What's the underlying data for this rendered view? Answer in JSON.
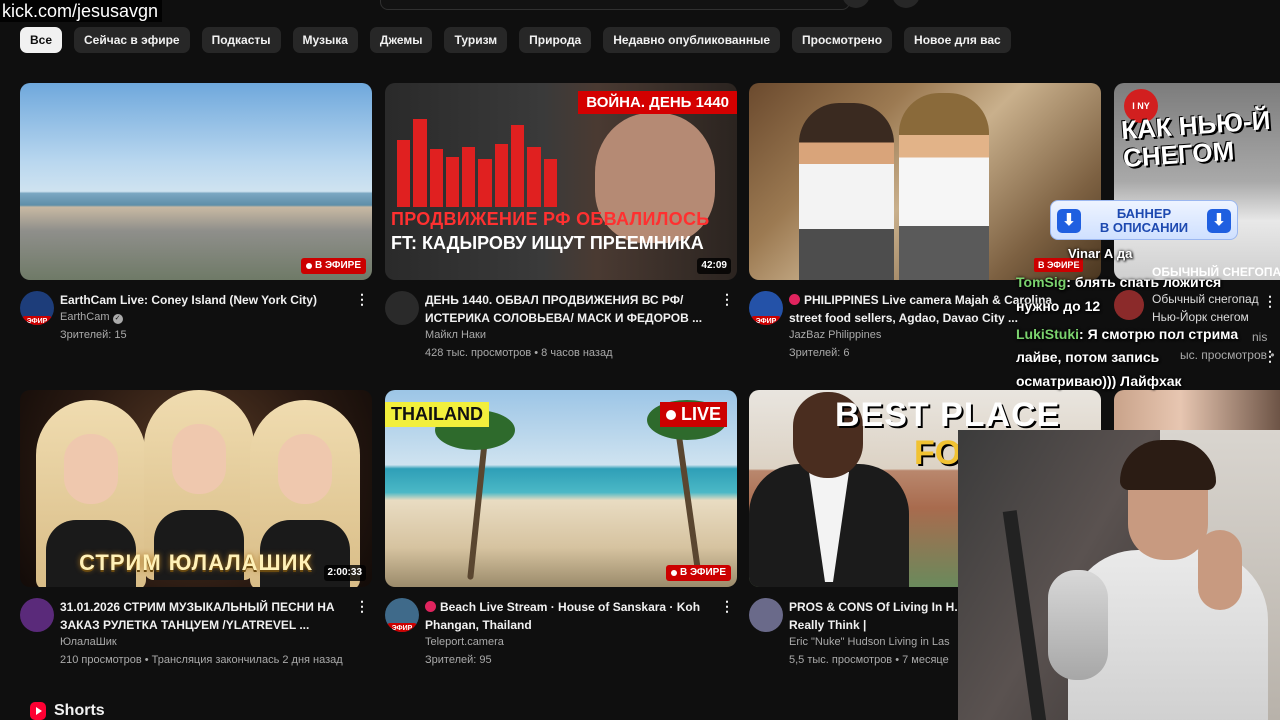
{
  "watermark": "kick.com/jesusavgn",
  "chips": [
    {
      "label": "Все",
      "active": true
    },
    {
      "label": "Сейчас в эфире"
    },
    {
      "label": "Подкасты"
    },
    {
      "label": "Музыка"
    },
    {
      "label": "Джемы"
    },
    {
      "label": "Туризм"
    },
    {
      "label": "Природа"
    },
    {
      "label": "Недавно опубликованные"
    },
    {
      "label": "Просмотрено"
    },
    {
      "label": "Новое для вас"
    }
  ],
  "videos": [
    {
      "title": "EarthCam Live:  Coney Island (New York City)",
      "channel": "EarthCam",
      "stats": "Зрителей: 15",
      "badge": "В ЭФИРЕ",
      "avatar_badge": "ЭФИР"
    },
    {
      "title": "ДЕНЬ 1440. ОБВАЛ ПРОДВИЖЕНИЯ ВС РФ/ ИСТЕРИКА СОЛОВЬЕВА/ МАСК И ФЕДОРОВ ...",
      "channel": "Майкл Наки",
      "stats": "428 тыс. просмотров • 8 часов назад",
      "duration": "42:09",
      "thumb_tag": "ВОЙНА. ДЕНЬ 1440",
      "thumb_line1": "ПРОДВИЖЕНИЕ РФ ОБВАЛИЛОСЬ",
      "thumb_line2": "FT: КАДЫРОВУ ИЩУТ ПРЕЕМНИКА"
    },
    {
      "title": "PHILIPPINES Live camera Majah & Carolina street food sellers, Agdao, Davao City ...",
      "channel": "JazBaz Philippines",
      "stats": "Зрителей: 6",
      "avatar_badge": "ЭФИР"
    },
    {
      "title": "31.01.2026 СТРИМ МУЗЫКАЛЬНЫЙ  ПЕСНИ НА ЗАКАЗ РУЛЕТКА ТАНЦУЕМ /YLATREVEL ...",
      "channel": "ЮлалаШик",
      "stats": "210 просмотров • Трансляция закончилась 2 дня назад",
      "duration": "2:00:33",
      "thumb_line1": "СТРИМ ЮЛАЛАШИК"
    },
    {
      "title": "Beach Live Stream · House of Sanskara · Koh Phangan, Thailand",
      "channel": "Teleport.camera",
      "stats": "Зрителей: 95",
      "badge": "В ЭФИРЕ",
      "avatar_badge": "ЭФИР",
      "thumb_tag": "THAILAND",
      "thumb_live": "LIVE"
    },
    {
      "title": "PROS & CONS Of Living In H... What LOCALS Really Think |",
      "channel": "Eric \"Nuke\" Hudson Living in Las",
      "stats": "5,5 тыс. просмотров • 7 месяце",
      "thumb_line1": "BEST PLACE",
      "thumb_line2": "FO"
    }
  ],
  "side": {
    "thumb_text": "КАК НЬЮ-Й\nСНЕГОМ",
    "thumb_apple": "I NY",
    "card_title": "ОБЫЧНЫЙ СНЕГОПА",
    "line1": "Обычный снегопад",
    "line2": "Нью-Йорк снегом",
    "line3": "nis",
    "line4": "ыс. просмотров •",
    "efir": "В ЭФИРЕ"
  },
  "banner": {
    "line1": "БАННЕР",
    "line2": "В ОПИСАНИИ",
    "arrow": "⬇"
  },
  "chat": [
    {
      "text": "А да",
      "nick": "Vinar"
    },
    {
      "nick": "TomSig",
      "text": ": блять спать ложится"
    },
    {
      "text": "нужно до 12"
    },
    {
      "nick": "LukiStuki",
      "text": ": Я смотрю пол стрима"
    },
    {
      "text": "лайве, потом запись"
    },
    {
      "text": "осматриваю))) Лайфхак"
    }
  ],
  "shorts": {
    "label": "Shorts"
  },
  "colors": {
    "background": "#0f0f0f",
    "chip": "#272727",
    "chip_active": "#f1f1f1",
    "live_red": "#cc0000",
    "secondary_text": "#aaaaaa"
  }
}
